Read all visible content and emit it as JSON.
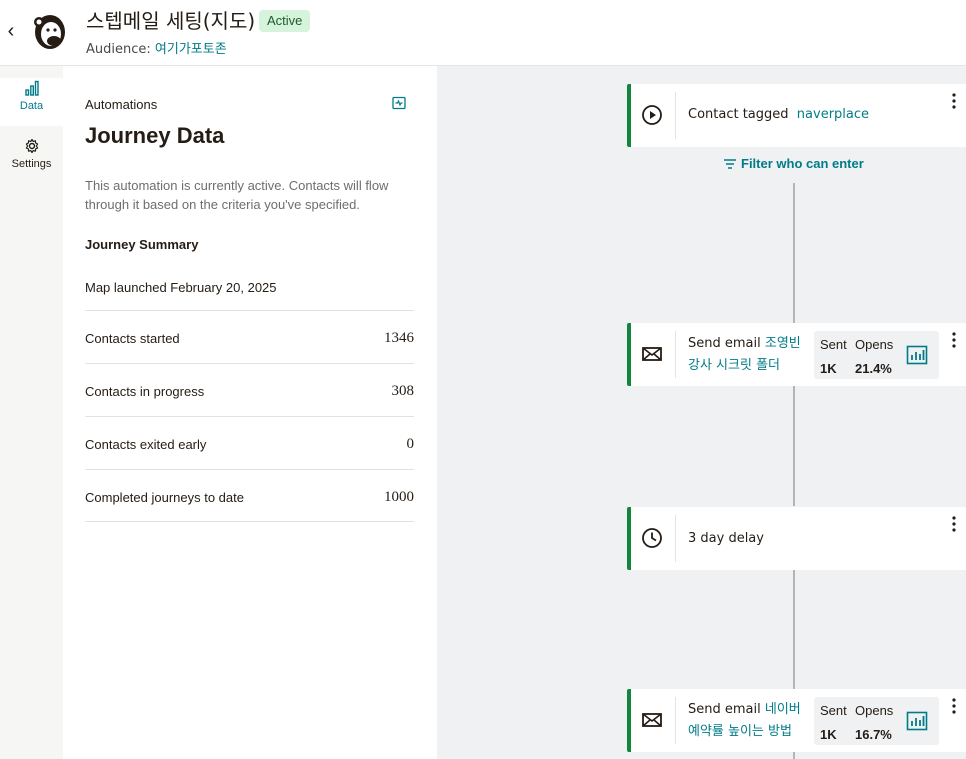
{
  "header": {
    "back_label": "‹",
    "title": "스텝메일 세팅(지도)",
    "status_badge": "Active",
    "audience_label": "Audience:",
    "audience_value": "여기가포토존"
  },
  "rail": {
    "items": [
      {
        "label": "Data",
        "icon": "bar-chart-icon",
        "active": true
      },
      {
        "label": "Settings",
        "icon": "gear-icon",
        "active": false
      }
    ]
  },
  "panel": {
    "label": "Automations",
    "title": "Journey Data",
    "description": "This automation is currently active. Contacts will flow through it based on the criteria you've specified.",
    "summary_heading": "Journey Summary",
    "launched": "Map launched February 20, 2025",
    "stats": [
      {
        "label": "Contacts started",
        "value": "1346"
      },
      {
        "label": "Contacts in progress",
        "value": "308"
      },
      {
        "label": "Contacts exited early",
        "value": "0"
      },
      {
        "label": "Completed journeys to date",
        "value": "1000"
      }
    ]
  },
  "canvas": {
    "filter_label": "Filter who can enter",
    "nodes": [
      {
        "type": "trigger",
        "icon": "play-circle-icon",
        "prefix": "Contact tagged",
        "link": "naverplace"
      },
      {
        "type": "email",
        "icon": "envelope-icon",
        "prefix": "Send email",
        "link_line1": "조영빈",
        "link_line2": "강사 시크릿 폴더",
        "sent_label": "Sent",
        "opens_label": "Opens",
        "sent": "1K",
        "opens": "21.4%"
      },
      {
        "type": "delay",
        "icon": "clock-icon",
        "text": "3 day delay"
      },
      {
        "type": "email",
        "icon": "envelope-icon",
        "prefix": "Send email",
        "link_line1": "네이버",
        "link_line2": "예약률 높이는 방법",
        "sent_label": "Sent",
        "opens_label": "Opens",
        "sent": "1K",
        "opens": "16.7%"
      }
    ]
  },
  "colors": {
    "accent": "#007c89",
    "active_border": "#14853d",
    "badge_bg": "#d6f3dc",
    "canvas_bg": "#eff1f3"
  }
}
